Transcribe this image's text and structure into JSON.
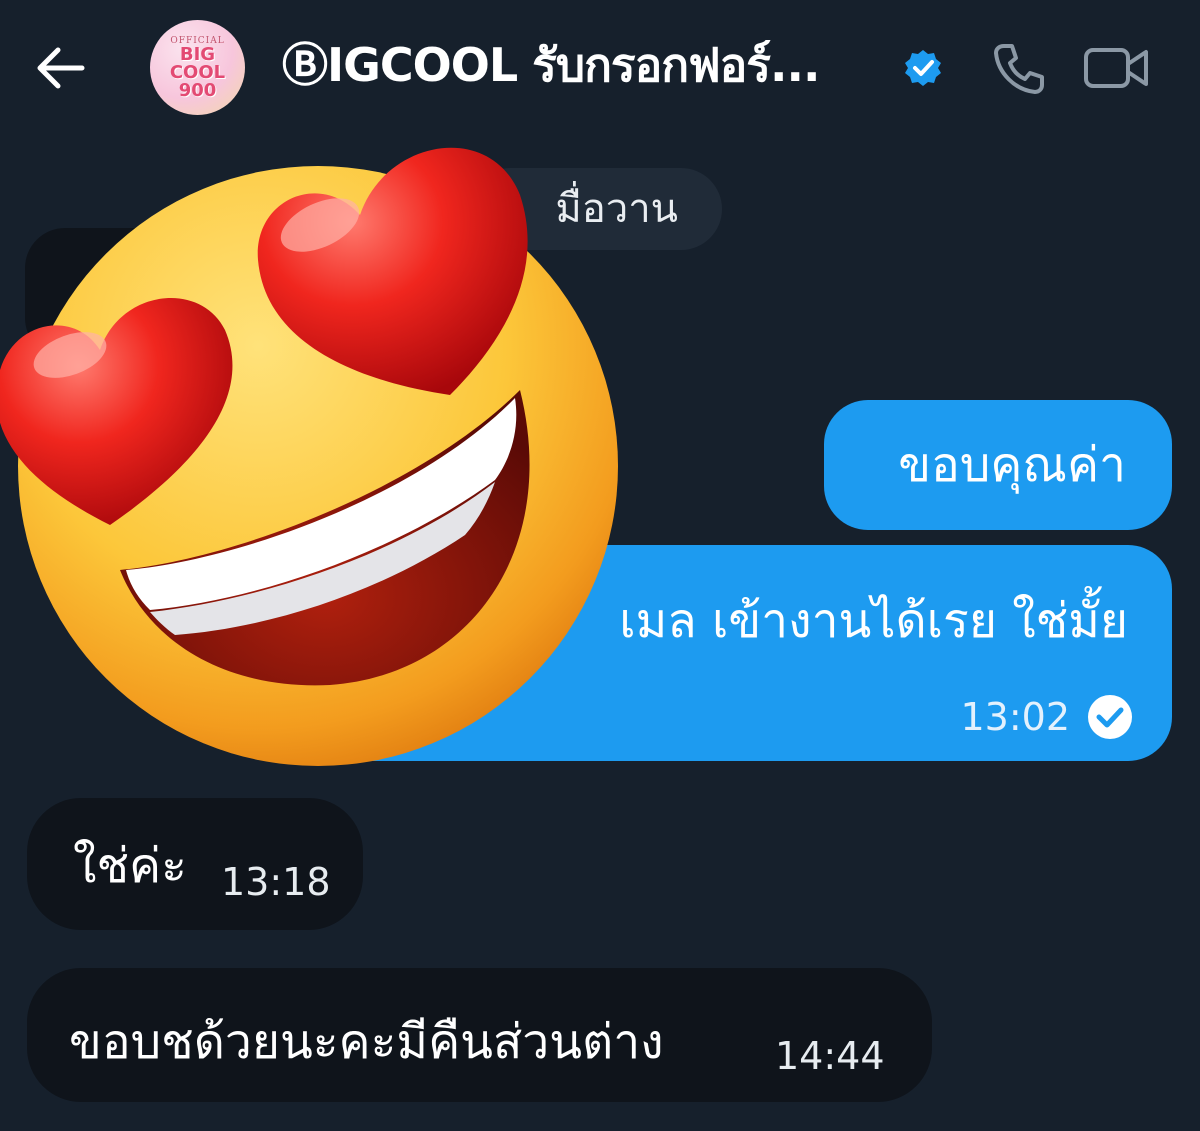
{
  "header": {
    "title": "ⒷIGCOOL รับกรอกฟอร์...",
    "avatar_text": {
      "top": "OFFICIAL",
      "line1": "BIG",
      "line2": "COOL",
      "line3": "900"
    },
    "icons": {
      "back": "arrow-left-icon",
      "verified": "verified-badge-icon",
      "call": "phone-icon",
      "video": "video-camera-icon"
    }
  },
  "conversation": {
    "date_separator": "มื่อวาน",
    "messages": [
      {
        "side": "out",
        "text": "ขอบคุณค่า"
      },
      {
        "side": "out",
        "text": "เมล เข้างานได้เรย ใช่มั้ย",
        "time": "13:02",
        "status_icon": "read-check-icon"
      },
      {
        "side": "in",
        "text": "ใช่ค่ะ",
        "time": "13:18"
      },
      {
        "side": "in",
        "text": "ขอบชด้วยนะคะมีคืนส่วนต่าง",
        "time": "14:44"
      }
    ]
  },
  "overlay": {
    "icon": "heart-eyes-emoji-icon"
  },
  "colors": {
    "background": "#16202c",
    "outgoing_bubble": "#1d9bf0",
    "incoming_bubble": "#0f141b",
    "verified": "#1d9bf0",
    "icon_gray": "#8b98a5"
  }
}
